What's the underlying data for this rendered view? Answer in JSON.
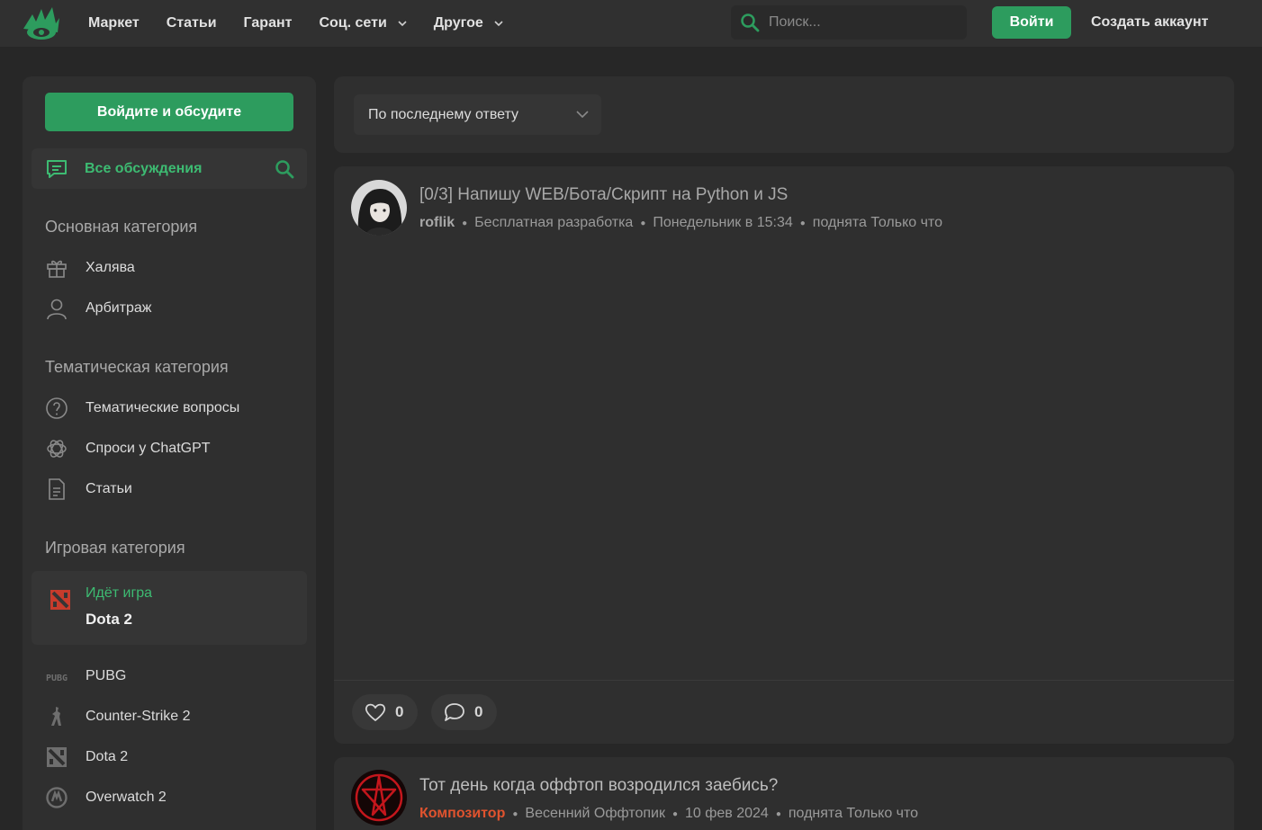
{
  "header": {
    "nav": [
      "Маркет",
      "Статьи",
      "Гарант",
      "Соц. сети",
      "Другое"
    ],
    "search_placeholder": "Поиск...",
    "login": "Войти",
    "register": "Создать аккаунт"
  },
  "sidebar": {
    "cta": "Войдите и обсудите",
    "all": "Все обсуждения",
    "sections": [
      {
        "title": "Основная категория",
        "items": [
          "Халява",
          "Арбитраж"
        ]
      },
      {
        "title": "Тематическая категория",
        "items": [
          "Тематические вопросы",
          "Спроси у ChatGPT",
          "Статьи"
        ]
      },
      {
        "title": "Игровая категория",
        "items": [
          "PUBG",
          "Counter-Strike 2",
          "Dota 2",
          "Overwatch 2"
        ]
      }
    ],
    "now_playing_label": "Идёт игра",
    "now_playing_game": "Dota 2"
  },
  "sort": {
    "selected": "По последнему ответу"
  },
  "thread": {
    "title": "[0/3] Напишу WEB/Бота/Скрипт на Python и JS",
    "author": "roflik",
    "category": "Бесплатная разработка",
    "date": "Понедельник в 15:34",
    "bumped": "поднята Только что",
    "likes": "0",
    "comments": "0"
  },
  "thread2": {
    "title": "Тот день когда оффтоп возродился заебись?",
    "author": "Композитор",
    "category": "Весенний Оффтопик",
    "date": "10 фев 2024",
    "bumped": "поднята Только что"
  },
  "colors": {
    "accent": "#2d9c5e",
    "accent_text": "#3dbb72",
    "bg": "#272727",
    "panel": "#2f2f2f"
  }
}
